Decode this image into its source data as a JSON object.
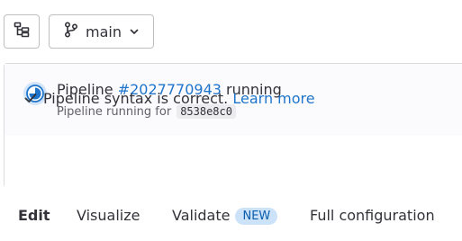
{
  "toolbar": {
    "tree_icon": "file-tree-icon",
    "branch_icon": "branch-icon",
    "branch_name": "main",
    "chevron_icon": "chevron-down-icon"
  },
  "pipeline": {
    "status_icon": "status-running-icon",
    "prefix": "Pipeline",
    "id_link": "#2027770943",
    "status": "running",
    "subtext": "Pipeline running for",
    "commit_sha": "8538e8c0"
  },
  "validation": {
    "check_icon": "check-icon",
    "message": "Pipeline syntax is correct.",
    "learn_more": "Learn more"
  },
  "tabs": [
    {
      "label": "Edit",
      "active": true
    },
    {
      "label": "Visualize",
      "active": false
    },
    {
      "label": "Validate",
      "active": false,
      "badge": "NEW"
    },
    {
      "label": "Full configuration",
      "active": false
    }
  ],
  "colors": {
    "link": "#1f75cb",
    "running": "#1f75cb",
    "badge_bg": "#cbe2f9"
  }
}
